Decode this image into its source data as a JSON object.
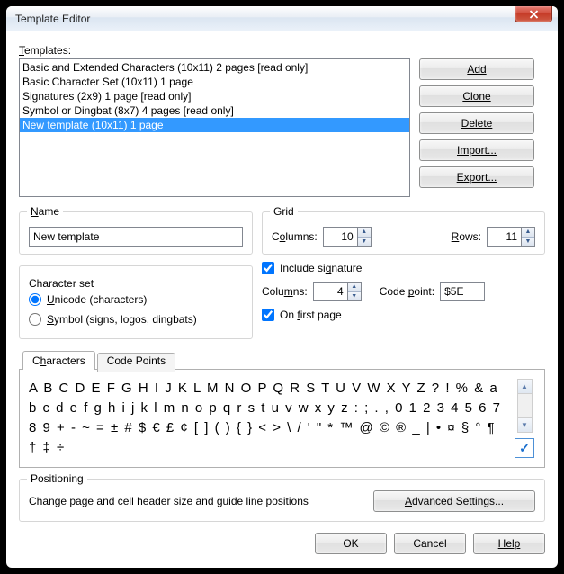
{
  "window": {
    "title": "Template Editor",
    "close_icon": "close-x"
  },
  "templates": {
    "label": "Templates:",
    "items": [
      "Basic and Extended Characters (10x11) 2 pages [read only]",
      "Basic Character Set (10x11) 1 page",
      "Signatures (2x9) 1 page [read only]",
      "Symbol or Dingbat (8x7) 4 pages [read only]",
      "New template (10x11) 1 page"
    ],
    "selected_index": 4
  },
  "buttons": {
    "add": "Add",
    "clone": "Clone",
    "delete": "Delete",
    "import": "Import...",
    "export": "Export...",
    "advanced": "Advanced Settings...",
    "ok": "OK",
    "cancel": "Cancel",
    "help": "Help"
  },
  "name": {
    "label": "Name",
    "value": "New template"
  },
  "grid": {
    "label": "Grid",
    "columns_label": "Columns:",
    "columns": "10",
    "rows_label": "Rows:",
    "rows": "11"
  },
  "charset": {
    "label": "Character set",
    "unicode": "Unicode (characters)",
    "symbol": "Symbol (signs, logos, dingbats)",
    "selected": "unicode"
  },
  "signature": {
    "include": "Include signature",
    "include_checked": true,
    "columns_label": "Columns:",
    "columns": "4",
    "codepoint_label": "Code point:",
    "codepoint": "$5E",
    "first_page": "On first page",
    "first_page_checked": true
  },
  "tabs": {
    "characters": "Characters",
    "codepoints": "Code Points",
    "active": "characters"
  },
  "characters_content": "A B C D E F G H I J K L M N O P Q R S T U V W X Y Z ? ! % & a b c d e f g h i j k l m n o p q r s t u v w x y z : ; . , 0 1 2 3 4 5 6 7 8 9 + - ~ = ± # $ € £ ¢ [ ] ( ) { } < > \\ / ' \" * ™ @ © ® _ | • ¤ § ° ¶ † ‡ ÷",
  "positioning": {
    "label": "Positioning",
    "desc": "Change page and cell header size and guide line positions"
  }
}
